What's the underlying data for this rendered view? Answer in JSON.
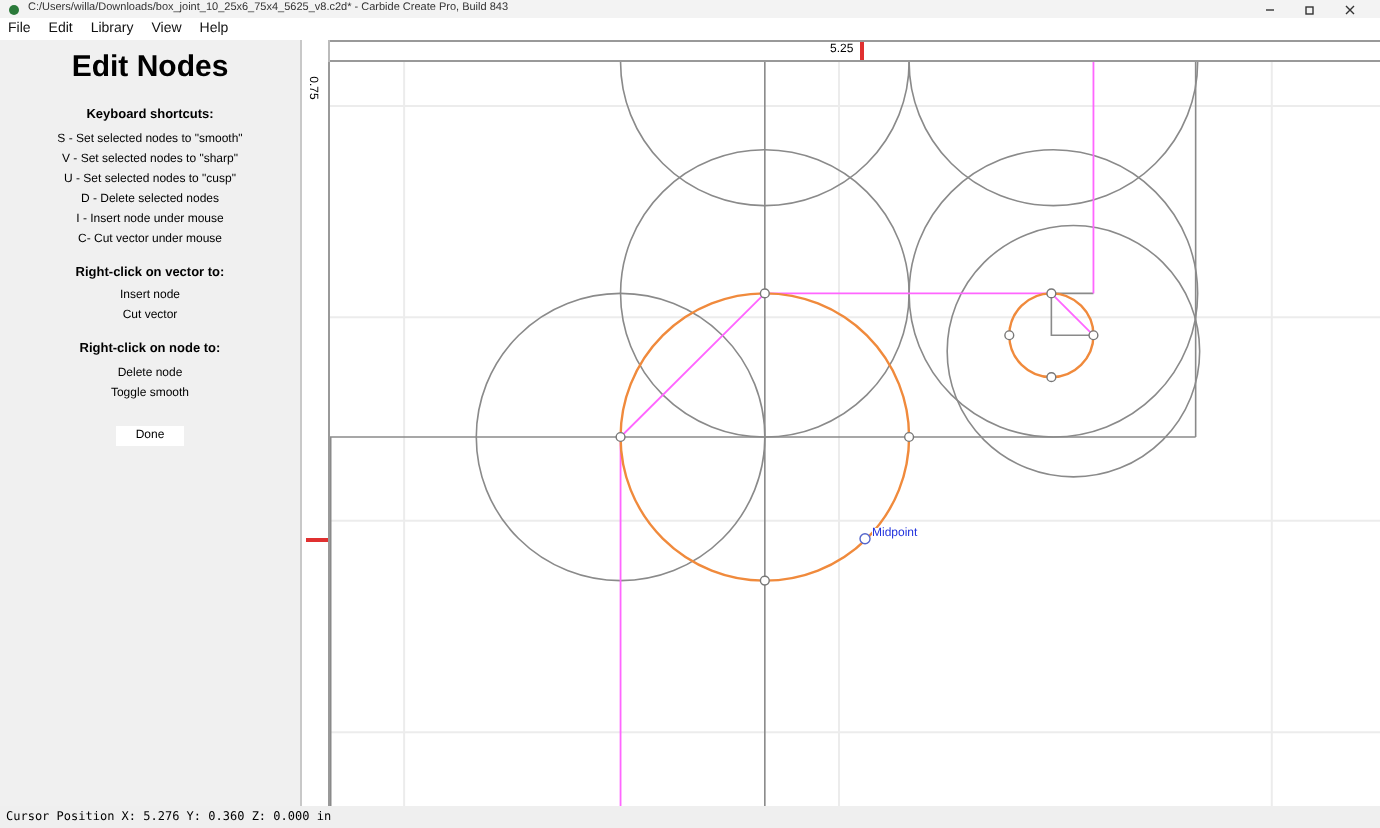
{
  "window": {
    "title": "C:/Users/willa/Downloads/box_joint_10_25x6_75x4_5625_v8.c2d* - Carbide Create Pro, Build 843"
  },
  "menu": [
    {
      "label": "File"
    },
    {
      "label": "Edit"
    },
    {
      "label": "Library"
    },
    {
      "label": "View"
    },
    {
      "label": "Help"
    }
  ],
  "panel": {
    "title": "Edit Nodes",
    "sections": [
      {
        "heading": "Keyboard shortcuts:",
        "lines": [
          "S - Set selected nodes to \"smooth\"",
          "V - Set selected nodes to \"sharp\"",
          "U - Set selected nodes to \"cusp\"",
          "D - Delete selected nodes",
          "I - Insert node under mouse",
          "C- Cut vector under mouse"
        ]
      },
      {
        "heading": "Right-click on vector to:",
        "lines": [
          "Insert node",
          "Cut vector"
        ]
      },
      {
        "heading": "Right-click on node to:",
        "lines": [
          "Delete node",
          "Toggle smooth"
        ]
      }
    ],
    "done_button": "Done"
  },
  "rulers": {
    "top_label": "5.25",
    "left_label": "0.75"
  },
  "canvas": {
    "snap_label": "Midpoint"
  },
  "status_bar": "Cursor Position X: 5.276 Y: 0.360 Z: 0.000 in"
}
